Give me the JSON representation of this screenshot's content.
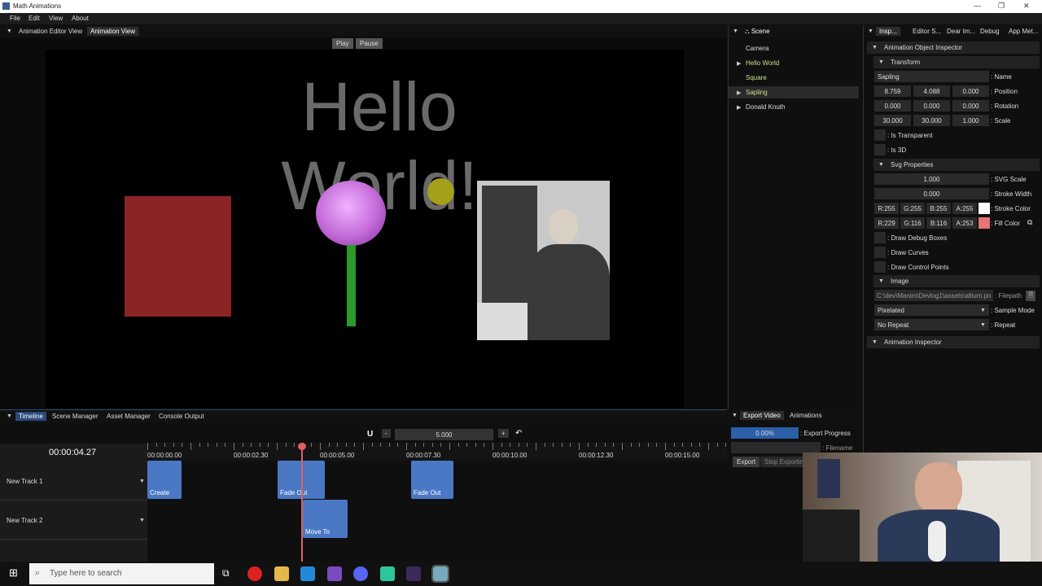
{
  "window": {
    "title": "Math Animations",
    "controls": [
      "—",
      "❐",
      "✕"
    ]
  },
  "menu": [
    "File",
    "Edit",
    "View",
    "About"
  ],
  "view_tabs": {
    "tab1": "Animation Editor View",
    "tab2": "Animation View"
  },
  "playback": {
    "play": "Play",
    "pause": "Pause"
  },
  "canvas": {
    "text": "Hello World!"
  },
  "scene": {
    "tab": "Scene",
    "items": [
      "Camera",
      "Hello World",
      "Square",
      "Sapling",
      "Donald Knuth"
    ]
  },
  "inspector": {
    "tabs": [
      "Insp...",
      "Editor S...",
      "Dear Im...",
      "Debug",
      "App Met..."
    ],
    "object_title": "Animation Object Inspector",
    "transform": "Transform",
    "name_value": "Sapling",
    "name_label": ": Name",
    "position": [
      "8.759",
      "4.088",
      "0.000"
    ],
    "position_label": ": Position",
    "rotation": [
      "0.000",
      "0.000",
      "0.000"
    ],
    "rotation_label": ": Rotation",
    "scale": [
      "30.000",
      "30.000",
      "1.000"
    ],
    "scale_label": ": Scale",
    "is_transparent": ": Is Transparent",
    "is_3d": ": Is 3D",
    "svg_props": "Svg Properties",
    "svg_scale": "1.000",
    "svg_scale_label": ": SVG Scale",
    "stroke_width": "0.000",
    "stroke_width_label": ": Stroke Width",
    "stroke": {
      "r": "R:255",
      "g": "G:255",
      "b": "B:255",
      "a": "A:255",
      "label": ": Stroke Color",
      "color": "#ffffff"
    },
    "fill": {
      "r": "R:229",
      "g": "G:116",
      "b": "B:116",
      "a": "A:253",
      "label": ": Fill Color",
      "color": "#e57474"
    },
    "draw_debug": ": Draw Debug Boxes",
    "draw_curves": ": Draw Curves",
    "draw_cp": ": Draw Control Points",
    "image": "Image",
    "filepath": "C:\\dev\\Manim\\Devlog1\\assets\\allium.pn",
    "filepath_label": ": Filepath",
    "sample_mode": "Pixelated",
    "sample_mode_label": ": Sample Mode",
    "repeat": "No Repeat",
    "repeat_label": ": Repeat",
    "anim_inspector": "Animation Inspector"
  },
  "bottom_tabs": [
    "Timeline",
    "Scene Manager",
    "Asset Manager",
    "Console Output"
  ],
  "timeline": {
    "magnet": "U",
    "minus": "-",
    "zoom": "5.000",
    "plus": "+",
    "undo": "↶",
    "current_time": "00:00:04.27",
    "ticks": [
      "00:00:00.00",
      "00:00:02.30",
      "00:00:05.00",
      "00:00:07.30",
      "00:00:10.00",
      "00:00:12.30",
      "00:00:15.00"
    ],
    "tracks": [
      "New Track 1",
      "New Track 2"
    ],
    "clips": [
      "Create",
      "Fade Out",
      "Fade Out",
      "Move To"
    ]
  },
  "export": {
    "tabs": [
      "Export Video",
      "Animations"
    ],
    "progress": "0.00%",
    "progress_label": ": Export Progress",
    "filename_label": ": Filename",
    "export_btn": "Export",
    "stop_btn": "Stop Exporting"
  },
  "taskbar": {
    "search_placeholder": "Type here to search"
  },
  "colors": {
    "accent": "#2b4a7a",
    "clip": "#4a78c4",
    "playhead": "#e06060",
    "square": "#8b2525"
  }
}
